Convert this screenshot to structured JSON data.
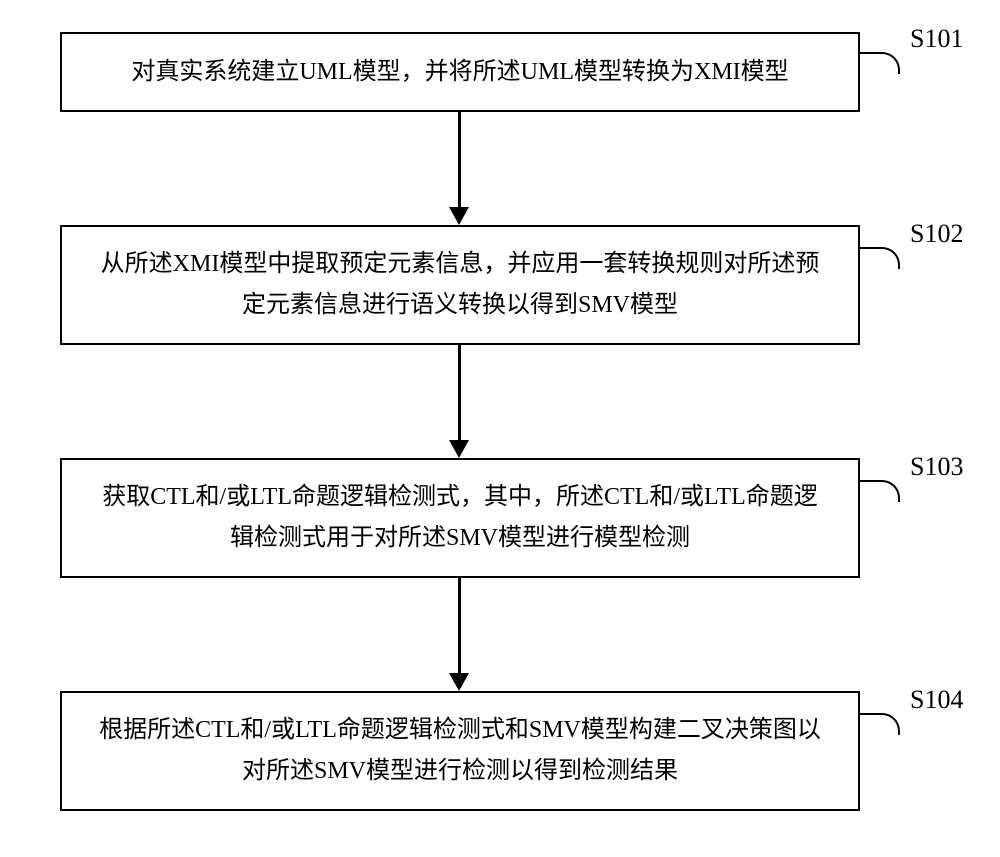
{
  "flow": {
    "steps": [
      {
        "label": "S101",
        "text": "对真实系统建立UML模型，并将所述UML模型转换为XMI模型"
      },
      {
        "label": "S102",
        "text": "从所述XMI模型中提取预定元素信息，并应用一套转换规则对所述预定元素信息进行语义转换以得到SMV模型"
      },
      {
        "label": "S103",
        "text": "获取CTL和/或LTL命题逻辑检测式，其中，所述CTL和/或LTL命题逻辑检测式用于对所述SMV模型进行模型检测"
      },
      {
        "label": "S104",
        "text": "根据所述CTL和/或LTL命题逻辑检测式和SMV模型构建二叉决策图以对所述SMV模型进行检测以得到检测结果"
      }
    ]
  }
}
